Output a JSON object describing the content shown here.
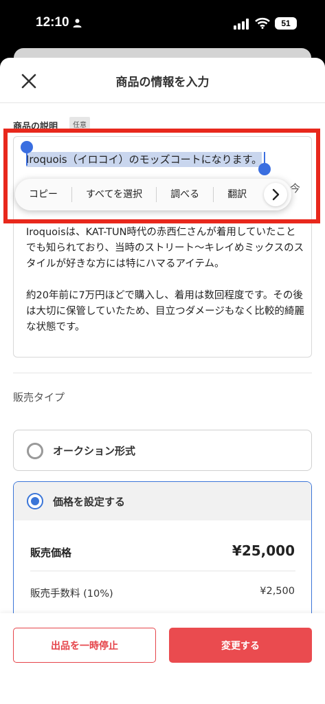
{
  "status_bar": {
    "time": "12:10",
    "battery": "51"
  },
  "nav": {
    "title": "商品の情報を入力"
  },
  "description": {
    "label": "商品の説明",
    "badge": "任意",
    "first_line": "Iroquois（イロコイ）のモッズコートになります。",
    "partial_char": "今",
    "paragraph1": "Iroquoisは、KAT-TUN時代の赤西仁さんが着用していたことでも知られており、当時のストリート〜キレイめミックスのスタイルが好きな方には特にハマるアイテム。",
    "paragraph2": "約20年前に7万円ほどで購入し、着用は数回程度です。その後は大切に保管していたため、目立つダメージもなく比較的綺麗な状態です。"
  },
  "context_menu": {
    "items": [
      "コピー",
      "すべてを選択",
      "調べる",
      "翻訳"
    ]
  },
  "sale_type": {
    "label": "販売タイプ",
    "auction": "オークション形式",
    "fixed_price": "価格を設定する"
  },
  "pricing": {
    "price_label": "販売価格",
    "price_value": "¥25,000",
    "fee_label": "販売手数料 (10%)",
    "fee_value": "¥2,500"
  },
  "footer": {
    "pause_label": "出品を一時停止",
    "change_label": "変更する"
  },
  "colors": {
    "accent_red": "#ea4b4f",
    "selection_blue": "#3a6ee0",
    "radio_blue": "#3a75d8",
    "annotation_red": "#e8281c"
  }
}
